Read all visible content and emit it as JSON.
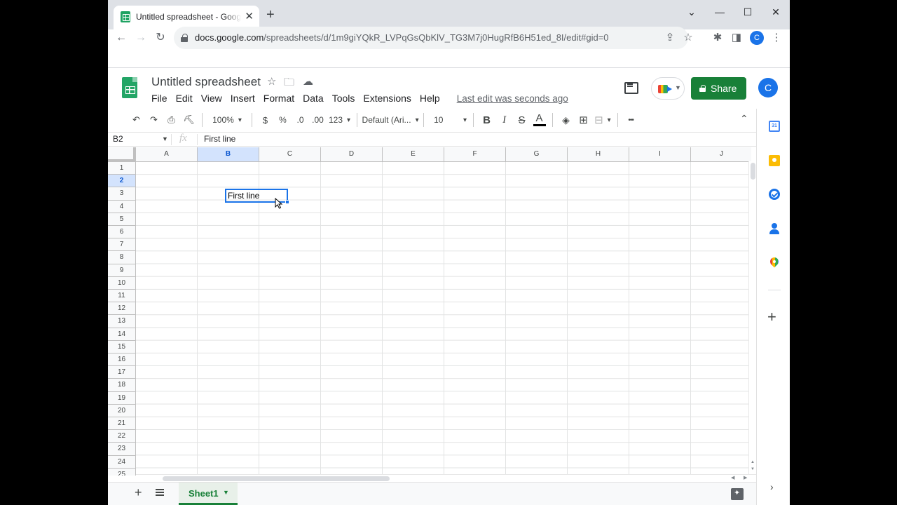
{
  "browser": {
    "tab_title": "Untitled spreadsheet - Google Sheets",
    "tab_close": "✕",
    "new_tab": "+",
    "window_controls": {
      "menu": "⌄",
      "minimize": "—",
      "maximize": "☐",
      "close": "✕"
    },
    "nav": {
      "back": "←",
      "forward": "→",
      "reload": "↻"
    },
    "url_host": "docs.google.com",
    "url_path": "/spreadsheets/d/1m9giYQkR_LVPqGsQbKlV_TG3M7j0HugRfB6H51ed_8I/edit#gid=0",
    "toolbar_icons": {
      "share": "⇪",
      "bookmark": "☆",
      "extensions": "✱",
      "sidepanel": "◨",
      "menu": "⋮"
    },
    "profile_initial": "C"
  },
  "docs": {
    "title": "Untitled spreadsheet",
    "title_icons": {
      "star": "☆",
      "move": "🗀",
      "cloud": "☁"
    },
    "menus": [
      "File",
      "Edit",
      "View",
      "Insert",
      "Format",
      "Data",
      "Tools",
      "Extensions",
      "Help"
    ],
    "last_edit": "Last edit was seconds ago",
    "share_label": "Share",
    "account_initial": "C"
  },
  "format_toolbar": {
    "undo": "↶",
    "redo": "↷",
    "print": "⎙",
    "paint_format": "⛏",
    "zoom": "100%",
    "currency": "$",
    "percent": "%",
    "decrease_decimal": ".0",
    "increase_decimal": ".00",
    "number_format": "123",
    "font": "Default (Ari...",
    "font_size": "10",
    "bold": "B",
    "italic": "I",
    "strikethrough": "S",
    "text_color": "A",
    "fill_color": "◈",
    "borders": "⊞",
    "merge": "⊟",
    "more": "•••",
    "collapse": "⌃"
  },
  "formula_bar": {
    "name_box": "B2",
    "fx": "fx",
    "content": "First line"
  },
  "grid": {
    "columns": [
      "A",
      "B",
      "C",
      "D",
      "E",
      "F",
      "G",
      "H",
      "I",
      "J"
    ],
    "selected_column": "B",
    "rows": [
      "1",
      "2",
      "3",
      "4",
      "5",
      "6",
      "7",
      "8",
      "9",
      "10",
      "11",
      "12",
      "13",
      "14",
      "15",
      "16",
      "17",
      "18",
      "19",
      "20",
      "21",
      "22",
      "23",
      "24",
      "25"
    ],
    "selected_row": "2",
    "active_cell": {
      "ref": "B2",
      "value": "First line"
    }
  },
  "sheet_tabs": {
    "add": "+",
    "tabs": [
      "Sheet1"
    ]
  },
  "side_panel": {
    "calendar_label": "31",
    "add": "+",
    "expand": "›"
  }
}
